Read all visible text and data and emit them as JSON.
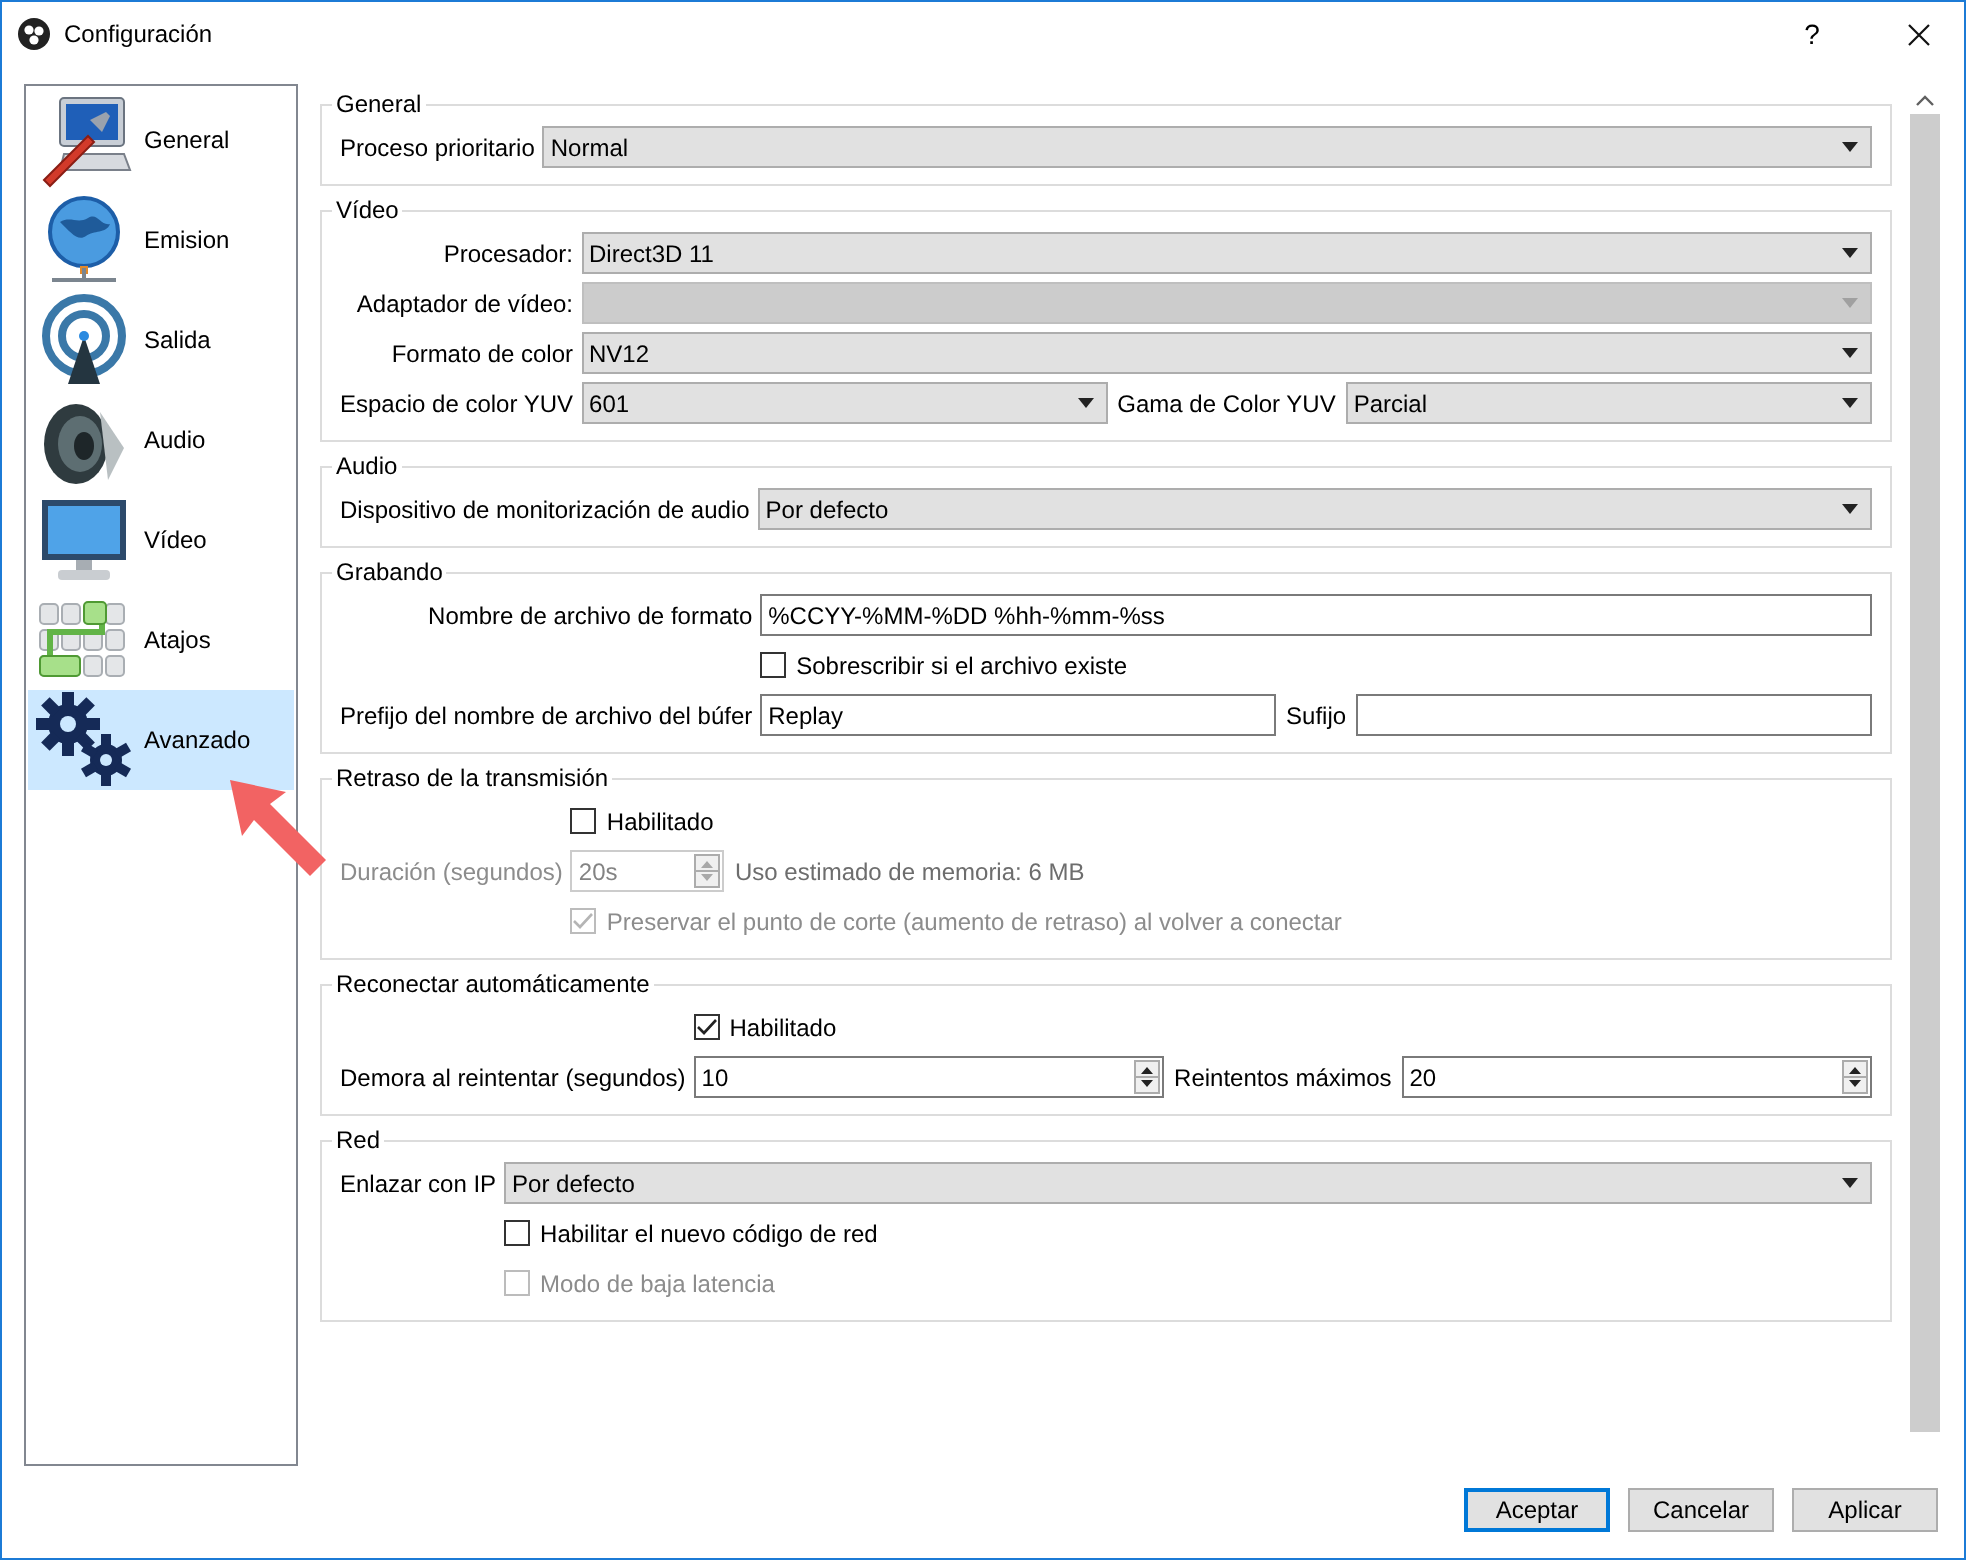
{
  "window": {
    "title": "Configuración",
    "help_button": "?"
  },
  "sidebar": {
    "items": [
      {
        "label": "General",
        "selected": false
      },
      {
        "label": "Emision",
        "selected": false
      },
      {
        "label": "Salida",
        "selected": false
      },
      {
        "label": "Audio",
        "selected": false
      },
      {
        "label": "Vídeo",
        "selected": false
      },
      {
        "label": "Atajos",
        "selected": false
      },
      {
        "label": "Avanzado",
        "selected": true
      }
    ]
  },
  "sections": [
    {
      "title": "General",
      "rows": [
        {
          "label": "Proceso prioritario",
          "disabled": false,
          "controls": [
            {
              "kind": "select",
              "value": "Normal",
              "disabled": false
            }
          ]
        }
      ]
    },
    {
      "title": "Vídeo",
      "rows": [
        {
          "label": "Procesador:",
          "disabled": false,
          "controls": [
            {
              "kind": "select",
              "value": "Direct3D 11",
              "disabled": false
            }
          ]
        },
        {
          "label": "Adaptador de vídeo:",
          "disabled": false,
          "controls": [
            {
              "kind": "select",
              "disabled": true
            }
          ]
        },
        {
          "label": "Formato de color",
          "disabled": false,
          "controls": [
            {
              "kind": "select",
              "value": "NV12",
              "disabled": false
            }
          ]
        },
        {
          "label": "Espacio de color YUV",
          "disabled": false,
          "controls": [
            {
              "kind": "select",
              "value": "601",
              "disabled": false
            },
            {
              "kind": "label",
              "text": "Gama de Color YUV",
              "disabled": false
            },
            {
              "kind": "select",
              "value": "Parcial",
              "disabled": false
            }
          ]
        }
      ]
    },
    {
      "title": "Audio",
      "rows": [
        {
          "label": "Dispositivo de monitorización de audio",
          "disabled": false,
          "controls": [
            {
              "kind": "select",
              "value": "Por defecto",
              "disabled": false
            }
          ]
        }
      ]
    },
    {
      "title": "Grabando",
      "rows": [
        {
          "label": "Nombre de archivo de formato",
          "disabled": false,
          "controls": [
            {
              "kind": "text",
              "value": "%CCYY-%MM-%DD %hh-%mm-%ss",
              "disabled": false
            }
          ]
        },
        {
          "controls": [
            {
              "kind": "checkbox",
              "label": "Sobrescribir si el archivo existe",
              "checked": false,
              "disabled": false
            }
          ]
        },
        {
          "label": "Prefijo del nombre de archivo del búfer",
          "disabled": false,
          "controls": [
            {
              "kind": "text",
              "value": "Replay",
              "disabled": false
            },
            {
              "kind": "label",
              "text": "Sufijo",
              "disabled": false
            },
            {
              "kind": "text",
              "disabled": false
            }
          ]
        }
      ]
    },
    {
      "title": "Retraso de la transmisión",
      "rows": [
        {
          "controls": [
            {
              "kind": "checkbox",
              "label": "Habilitado",
              "checked": false,
              "disabled": false
            }
          ]
        },
        {
          "label": "Duración (segundos)",
          "disabled": true,
          "controls": [
            {
              "kind": "spin",
              "value": "20s",
              "disabled": true
            },
            {
              "kind": "note",
              "text": "Uso estimado de memoria: 6 MB",
              "disabled": true
            }
          ]
        },
        {
          "controls": [
            {
              "kind": "checkbox",
              "label": "Preservar el punto de corte (aumento de retraso) al volver a conectar",
              "checked": true,
              "disabled": true
            }
          ]
        }
      ]
    },
    {
      "title": "Reconectar automáticamente",
      "rows": [
        {
          "controls": [
            {
              "kind": "checkbox",
              "label": "Habilitado",
              "checked": true,
              "disabled": false
            }
          ]
        },
        {
          "label": "Demora al reintentar (segundos)",
          "disabled": false,
          "controls": [
            {
              "kind": "spin",
              "value": "10",
              "disabled": false
            },
            {
              "kind": "label",
              "text": "Reintentos máximos",
              "disabled": false
            },
            {
              "kind": "spin",
              "value": "20",
              "disabled": false
            }
          ]
        }
      ]
    },
    {
      "title": "Red",
      "rows": [
        {
          "label": "Enlazar con IP",
          "disabled": false,
          "controls": [
            {
              "kind": "select",
              "value": "Por defecto",
              "disabled": false
            }
          ]
        },
        {
          "controls": [
            {
              "kind": "checkbox",
              "label": "Habilitar el nuevo código de red",
              "checked": false,
              "disabled": false
            }
          ]
        },
        {
          "controls": [
            {
              "kind": "checkbox",
              "label": "Modo de baja latencia",
              "checked": false,
              "disabled": true
            }
          ]
        }
      ]
    }
  ],
  "buttons": [
    {
      "label": "Aceptar",
      "default": true
    },
    {
      "label": "Cancelar",
      "default": false
    },
    {
      "label": "Aplicar",
      "default": false
    }
  ]
}
